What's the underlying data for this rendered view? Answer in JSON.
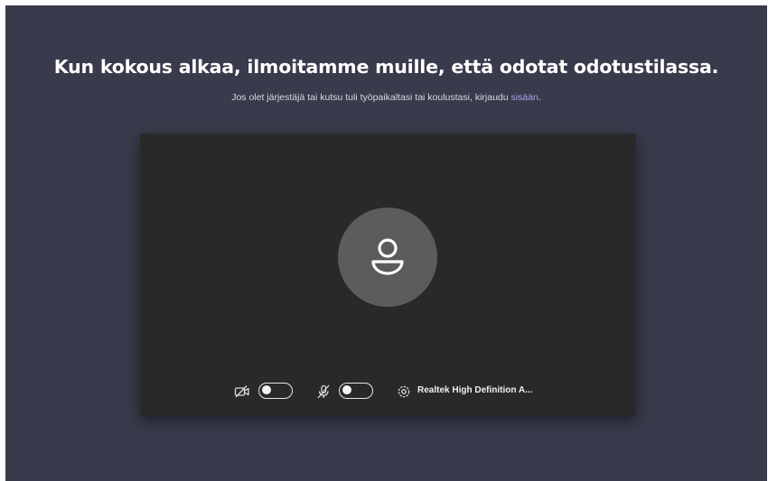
{
  "header": {
    "title": "Kun kokous alkaa, ilmoitamme muille, että odotat odotustilassa.",
    "subtitle_text": "Jos olet järjestäjä tai kutsu tuli työpaikaltasi tai koulustasi, kirjaudu ",
    "signin_link": "sisään",
    "subtitle_end": "."
  },
  "preview": {
    "avatar_icon": "person-icon",
    "video_icon": "video-off-icon",
    "video_toggle_state": "off",
    "mic_icon": "mic-off-icon",
    "mic_toggle_state": "off",
    "settings_icon": "gear-icon",
    "device_label": "Realtek High Definition A..."
  },
  "colors": {
    "background": "#393a4b",
    "preview": "#292929",
    "avatar": "#5c5c5c",
    "link": "#a7a9f0"
  }
}
